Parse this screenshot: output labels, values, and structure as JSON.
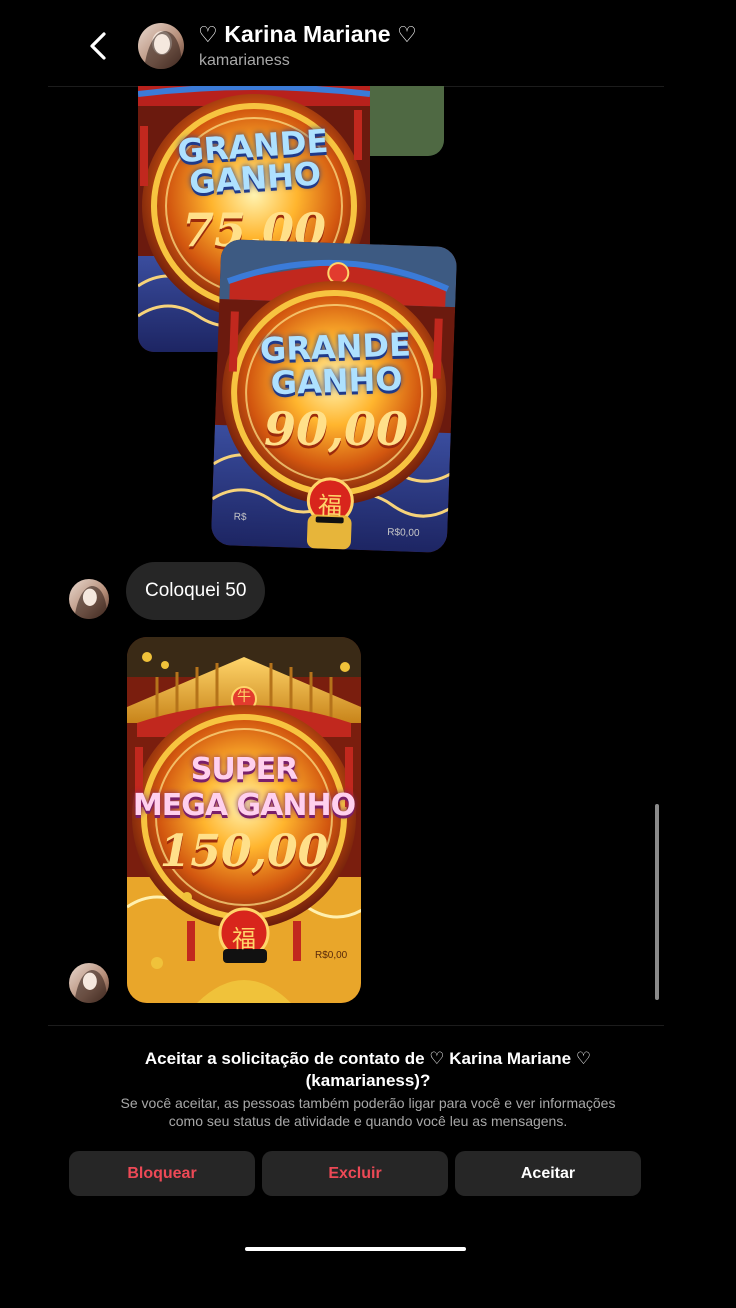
{
  "header": {
    "display_name": "Karina Mariane",
    "heart": "♡",
    "username": "kamarianess"
  },
  "media": {
    "card1": {
      "line1": "GRANDE",
      "line2": "GANHO",
      "amount": "75,00"
    },
    "card2": {
      "line1": "GRANDE",
      "line2": "GANHO",
      "amount": "90,00",
      "footer_left": "R$",
      "footer_right": "R$0,00"
    },
    "card3": {
      "line1": "SUPER",
      "line2": "MEGA GANHO",
      "amount": "150,00",
      "footer_right": "R$0,00",
      "charm": "福",
      "top_charm": "牛"
    }
  },
  "messages": [
    {
      "text": "Coloquei 50"
    }
  ],
  "request": {
    "title_prefix": "Aceitar a solicitação de contato de",
    "title_name": "♡ Karina Mariane ♡",
    "title_username": "(kamarianess)?",
    "description_line1": "Se você aceitar, as pessoas também poderão ligar para você e ver informações",
    "description_line2": "como seu status de atividade e quando você leu as mensagens.",
    "block_label": "Bloquear",
    "delete_label": "Excluir",
    "accept_label": "Aceitar"
  },
  "colors": {
    "background": "#000000",
    "bubble": "#262626",
    "danger": "#ed4956",
    "secondary_text": "#a8a8a8"
  }
}
